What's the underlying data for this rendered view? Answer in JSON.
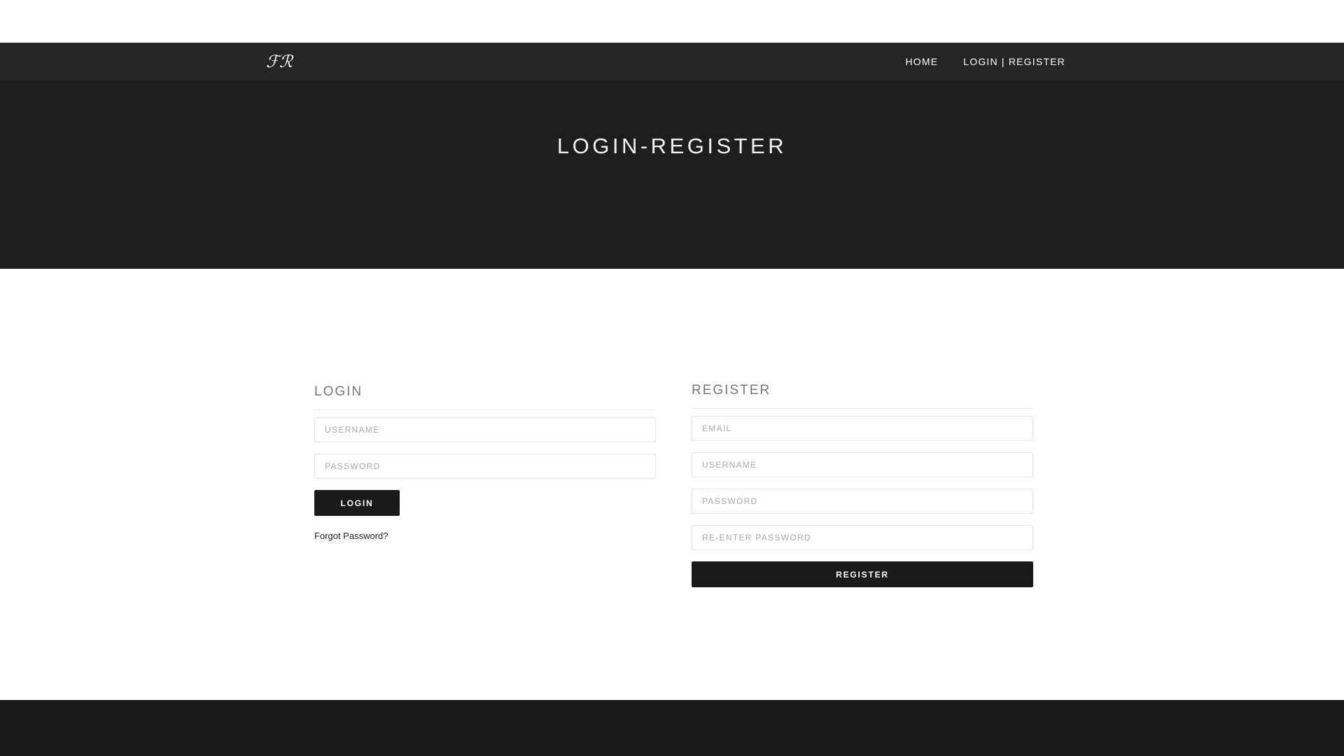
{
  "brand": {
    "logo_text": "ℱℛ"
  },
  "nav": {
    "home_label": "HOME",
    "login_register_label": "LOGIN | REGISTER"
  },
  "hero": {
    "title": "LOGIN-REGISTER"
  },
  "login": {
    "heading": "LOGIN",
    "username_placeholder": "USERNAME",
    "password_placeholder": "PASSWORD",
    "button_label": "LOGIN",
    "forgot_label": "Forgot Password?"
  },
  "register": {
    "heading": "REGISTER",
    "email_placeholder": "EMAIL",
    "username_placeholder": "USERNAME",
    "password_placeholder": "PASSWORD",
    "reenter_placeholder": "RE-ENTER PASSWORD",
    "button_label": "REGISTER"
  },
  "colors": {
    "navbar": "#252525",
    "hero": "#1e1e1e",
    "footer": "#1a1a1a",
    "button": "#1b1b1b"
  }
}
